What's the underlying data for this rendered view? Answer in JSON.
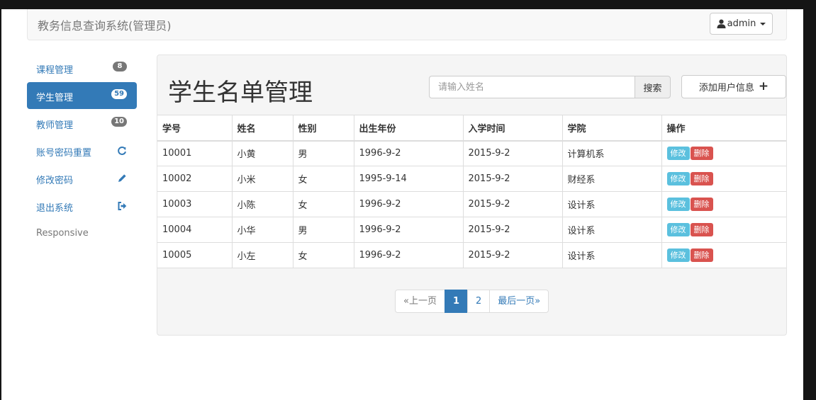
{
  "app": {
    "title": "教务信息查询系统(管理员)",
    "user": "admin"
  },
  "sidebar": {
    "items": [
      {
        "label": "课程管理",
        "badge": "8"
      },
      {
        "label": "学生管理",
        "badge": "59",
        "active": true
      },
      {
        "label": "教师管理",
        "badge": "10"
      },
      {
        "label": "账号密码重置",
        "icon": "refresh-icon"
      },
      {
        "label": "修改密码",
        "icon": "pencil-icon"
      },
      {
        "label": "退出系统",
        "icon": "logout-icon"
      },
      {
        "label": "Responsive"
      }
    ]
  },
  "main": {
    "title": "学生名单管理",
    "search": {
      "placeholder": "请输入姓名",
      "button": "搜索"
    },
    "add_button": "添加用户信息"
  },
  "table": {
    "headers": [
      "学号",
      "姓名",
      "性别",
      "出生年份",
      "入学时间",
      "学院",
      "操作"
    ],
    "rows": [
      [
        "10001",
        "小黄",
        "男",
        "1996-9-2",
        "2015-9-2",
        "计算机系"
      ],
      [
        "10002",
        "小米",
        "女",
        "1995-9-14",
        "2015-9-2",
        "财经系"
      ],
      [
        "10003",
        "小陈",
        "女",
        "1996-9-2",
        "2015-9-2",
        "设计系"
      ],
      [
        "10004",
        "小华",
        "男",
        "1996-9-2",
        "2015-9-2",
        "设计系"
      ],
      [
        "10005",
        "小左",
        "女",
        "1996-9-2",
        "2015-9-2",
        "设计系"
      ]
    ],
    "actions": {
      "edit": "修改",
      "delete": "删除"
    }
  },
  "pagination": {
    "prev": "«上一页",
    "pages": [
      "1",
      "2"
    ],
    "current": "1",
    "last": "最后一页»"
  },
  "colors": {
    "primary": "#337ab7",
    "info": "#5bc0de",
    "danger": "#d9534f",
    "badge": "#777777"
  }
}
